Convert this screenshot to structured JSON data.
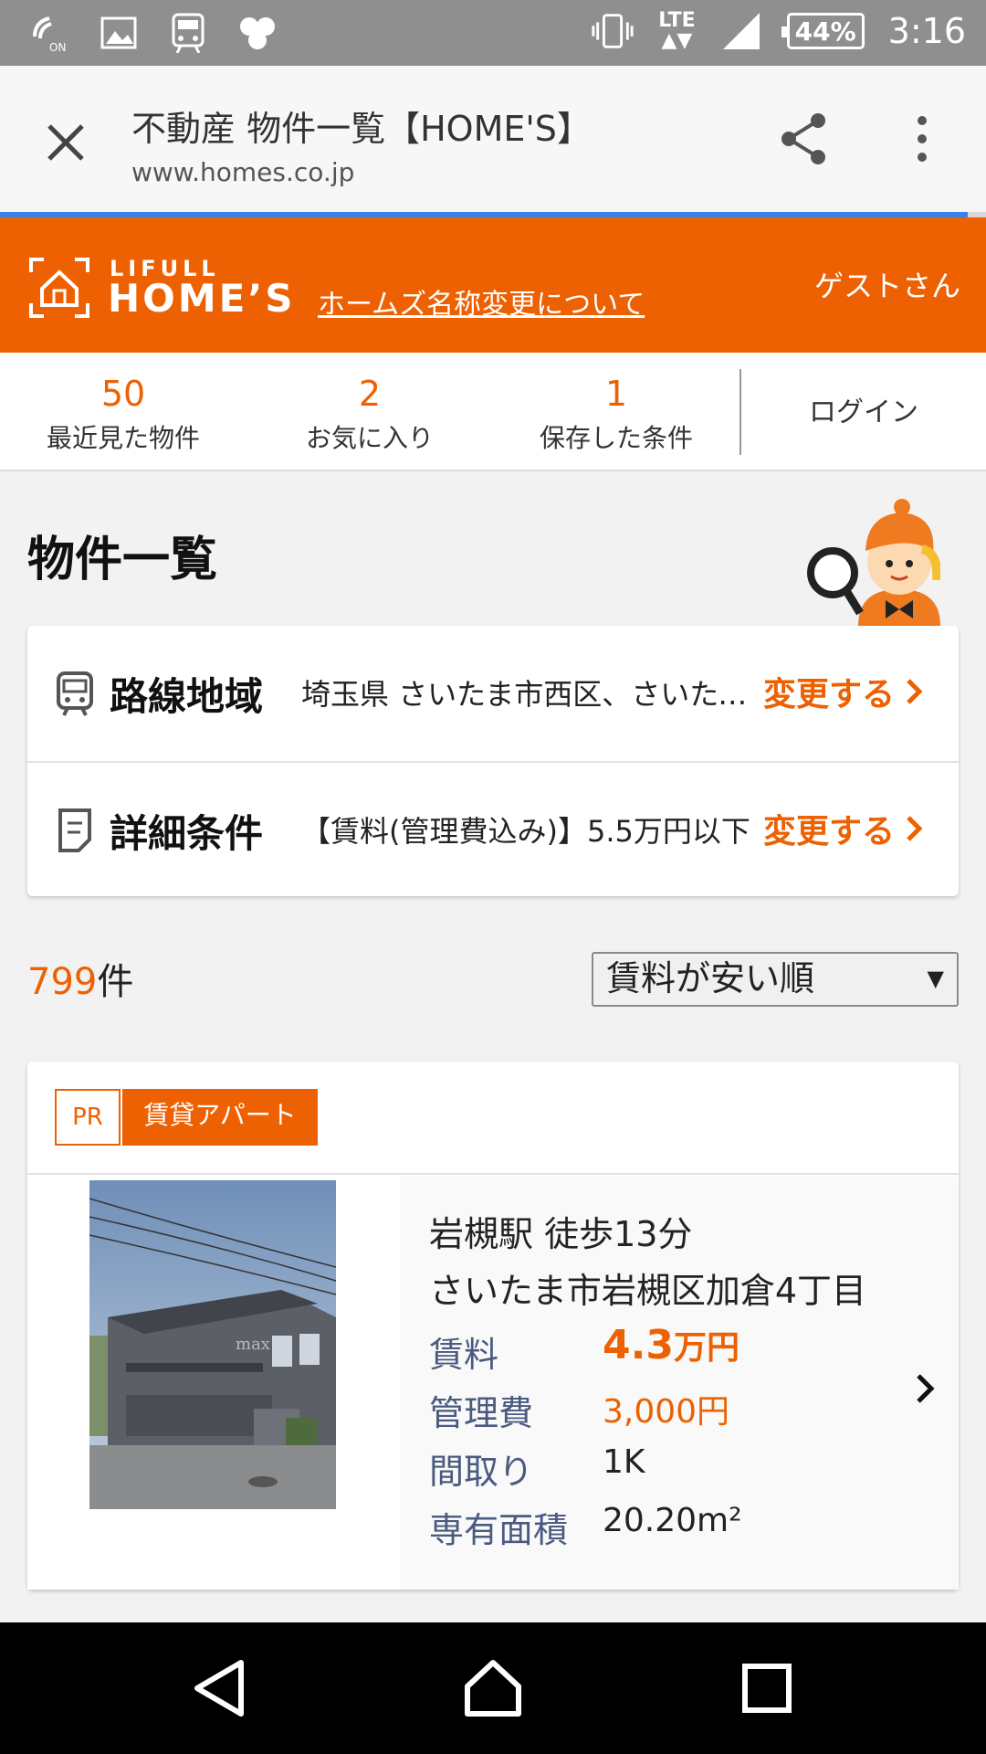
{
  "status_bar": {
    "battery": "44%",
    "time": "3:16",
    "network": "LTE",
    "icons": [
      "wifi-calling-icon",
      "image-icon",
      "train-icon",
      "app-icon",
      "vibrate-icon",
      "signal-icon",
      "battery-icon"
    ]
  },
  "browser": {
    "page_title": "不動産 物件一覧【HOME'S】",
    "url": "www.homes.co.jp"
  },
  "header": {
    "logo_top": "LIFULL",
    "logo_main": "HOME’S",
    "rename_link": "ホームズ名称変更について",
    "guest": "ゲストさん"
  },
  "stats": [
    {
      "count": "50",
      "label": "最近見た物件"
    },
    {
      "count": "2",
      "label": "お気に入り"
    },
    {
      "count": "1",
      "label": "保存した条件"
    }
  ],
  "login": "ログイン",
  "section_title": "物件一覧",
  "conditions": [
    {
      "label": "路線地域",
      "value": "埼玉県 さいたま市西区、さいたま市北区",
      "change": "変更する"
    },
    {
      "label": "詳細条件",
      "value": "【賃料(管理費込み)】5.5万円以下",
      "change": "変更する"
    }
  ],
  "results": {
    "count": "799",
    "unit": "件",
    "sort": "賃料が安い順",
    "sort_arrow": "▼"
  },
  "listing": {
    "pr": "PR",
    "type": "賃貸アパート",
    "station": "岩槻駅 徒歩13分",
    "address": "さいたま市岩槻区加倉4丁目",
    "rent_label": "賃料",
    "rent_value": "4.3",
    "rent_unit": "万円",
    "fee_label": "管理費",
    "fee_value": "3,000円",
    "layout_label": "間取り",
    "layout_value": "1K",
    "area_label": "専有面積",
    "area_value": "20.20m²"
  },
  "colors": {
    "brand": "#ed6103",
    "status_bar": "#8f8f8f",
    "progress": "#3b82e8"
  }
}
